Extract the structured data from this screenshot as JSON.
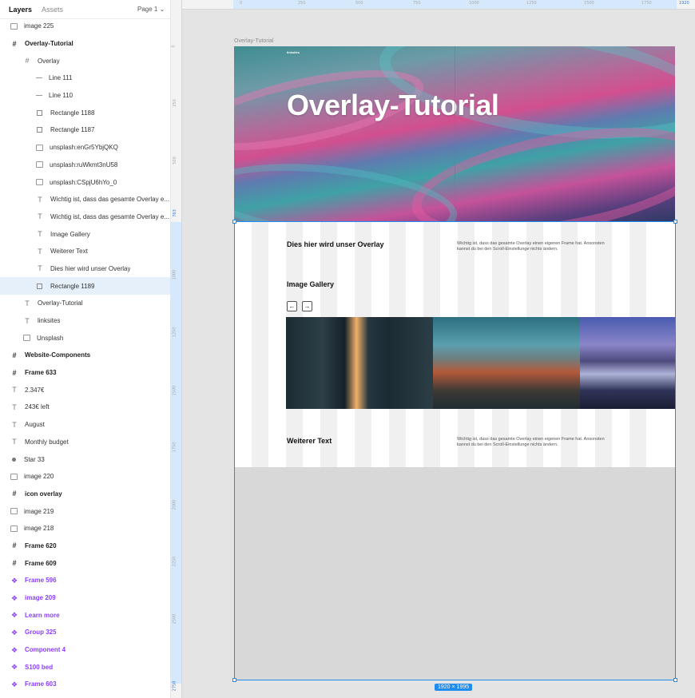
{
  "panel": {
    "tabs": [
      "Layers",
      "Assets"
    ],
    "page_selector": "Page 1 ⌄",
    "layers": [
      {
        "label": "image 225",
        "icon": "image-icon",
        "indent": 0,
        "style": "normal"
      },
      {
        "label": "Overlay-Tutorial",
        "icon": "frame-icon",
        "indent": 0,
        "style": "bold"
      },
      {
        "label": "Overlay",
        "icon": "frame-icon",
        "indent": 1,
        "style": "normal"
      },
      {
        "label": "Line 111",
        "icon": "line-icon",
        "indent": 2,
        "style": "normal"
      },
      {
        "label": "Line 110",
        "icon": "line-icon",
        "indent": 2,
        "style": "normal"
      },
      {
        "label": "Rectangle 1188",
        "icon": "rectangle-icon",
        "indent": 2,
        "style": "normal"
      },
      {
        "label": "Rectangle 1187",
        "icon": "rectangle-icon",
        "indent": 2,
        "style": "normal"
      },
      {
        "label": "unsplash:enGr5YbjQKQ",
        "icon": "image-icon",
        "indent": 2,
        "style": "normal"
      },
      {
        "label": "unsplash:ruWkmt3nU58",
        "icon": "image-icon",
        "indent": 2,
        "style": "normal"
      },
      {
        "label": "unsplash:CSpjU6hYo_0",
        "icon": "image-icon",
        "indent": 2,
        "style": "normal"
      },
      {
        "label": "Wichtig ist, dass das gesamte Overlay e...",
        "icon": "text-icon",
        "indent": 2,
        "style": "normal"
      },
      {
        "label": "Wichtig ist, dass das gesamte Overlay e...",
        "icon": "text-icon",
        "indent": 2,
        "style": "normal"
      },
      {
        "label": "Image Gallery",
        "icon": "text-icon",
        "indent": 2,
        "style": "normal"
      },
      {
        "label": "Weiterer Text",
        "icon": "text-icon",
        "indent": 2,
        "style": "normal"
      },
      {
        "label": "Dies hier wird unser Overlay",
        "icon": "text-icon",
        "indent": 2,
        "style": "normal"
      },
      {
        "label": "Rectangle 1189",
        "icon": "rectangle-icon",
        "indent": 2,
        "style": "selected"
      },
      {
        "label": "Overlay-Tutorial",
        "icon": "text-icon",
        "indent": 1,
        "style": "normal"
      },
      {
        "label": "linksites",
        "icon": "text-icon",
        "indent": 1,
        "style": "normal"
      },
      {
        "label": "Unsplash",
        "icon": "image-icon",
        "indent": 1,
        "style": "normal"
      },
      {
        "label": "Website-Components",
        "icon": "frame-icon",
        "indent": 0,
        "style": "bold"
      },
      {
        "label": "Frame 633",
        "icon": "frame-icon",
        "indent": 0,
        "style": "bold"
      },
      {
        "label": "2.347€",
        "icon": "text-icon",
        "indent": 0,
        "style": "normal"
      },
      {
        "label": "243€ left",
        "icon": "text-icon",
        "indent": 0,
        "style": "normal"
      },
      {
        "label": "August",
        "icon": "text-icon",
        "indent": 0,
        "style": "normal"
      },
      {
        "label": "Monthly budget",
        "icon": "text-icon",
        "indent": 0,
        "style": "normal"
      },
      {
        "label": "Star 33",
        "icon": "star-icon",
        "indent": 0,
        "style": "normal"
      },
      {
        "label": "image 220",
        "icon": "image-icon",
        "indent": 0,
        "style": "normal"
      },
      {
        "label": "icon overlay",
        "icon": "frame-icon",
        "indent": 0,
        "style": "bold"
      },
      {
        "label": "image 219",
        "icon": "image-icon",
        "indent": 0,
        "style": "normal"
      },
      {
        "label": "image 218",
        "icon": "image-icon",
        "indent": 0,
        "style": "normal"
      },
      {
        "label": "Frame 620",
        "icon": "frame-icon",
        "indent": 0,
        "style": "bold"
      },
      {
        "label": "Frame 609",
        "icon": "frame-icon",
        "indent": 0,
        "style": "bold"
      },
      {
        "label": "Frame 596",
        "icon": "component-icon",
        "indent": 0,
        "style": "component"
      },
      {
        "label": "image 209",
        "icon": "component-icon",
        "indent": 0,
        "style": "component"
      },
      {
        "label": "Learn more",
        "icon": "component-icon",
        "indent": 0,
        "style": "component"
      },
      {
        "label": "Group 325",
        "icon": "component-icon",
        "indent": 0,
        "style": "component"
      },
      {
        "label": "Component 4",
        "icon": "component-icon",
        "indent": 0,
        "style": "component"
      },
      {
        "label": "S100 bed",
        "icon": "component-icon",
        "indent": 0,
        "style": "component"
      },
      {
        "label": "Frame 603",
        "icon": "component-icon",
        "indent": 0,
        "style": "component"
      }
    ]
  },
  "rulers": {
    "top_ticks": [
      "0",
      "250",
      "500",
      "750",
      "1000",
      "1250",
      "1500",
      "1750",
      "1920"
    ],
    "left_ticks": [
      "0",
      "250",
      "500",
      "763",
      "1000",
      "1250",
      "1500",
      "1750",
      "2000",
      "2250",
      "2500",
      "2758"
    ]
  },
  "canvas": {
    "frame_label": "Overlay-Tutorial",
    "hero": {
      "brand": "linksites",
      "title": "Overlay-Tutorial"
    },
    "overlay": {
      "heading1": "Dies  hier wird unser Overlay",
      "paragraph1": "Wichtig ist, dass das gesamte Overlay einen eigenen Frame hat. Ansonsten kannst du bei den Scroll-Einstellunge nichts ändern.",
      "gallery_heading": "Image Gallery",
      "prev_arrow": "←",
      "next_arrow": "→",
      "heading2": "Weiterer Text",
      "paragraph2": "Wichtig ist, dass das gesamte Overlay einen eigenen Frame hat. Ansonsten kannst du bei den Scroll-Einstellunge nichts ändern."
    },
    "dimensions_badge": "1920 × 1995"
  },
  "colors": {
    "selection": "#1f8cf0",
    "component": "#8a3ffc",
    "canvas_bg": "#e4e4e4"
  }
}
